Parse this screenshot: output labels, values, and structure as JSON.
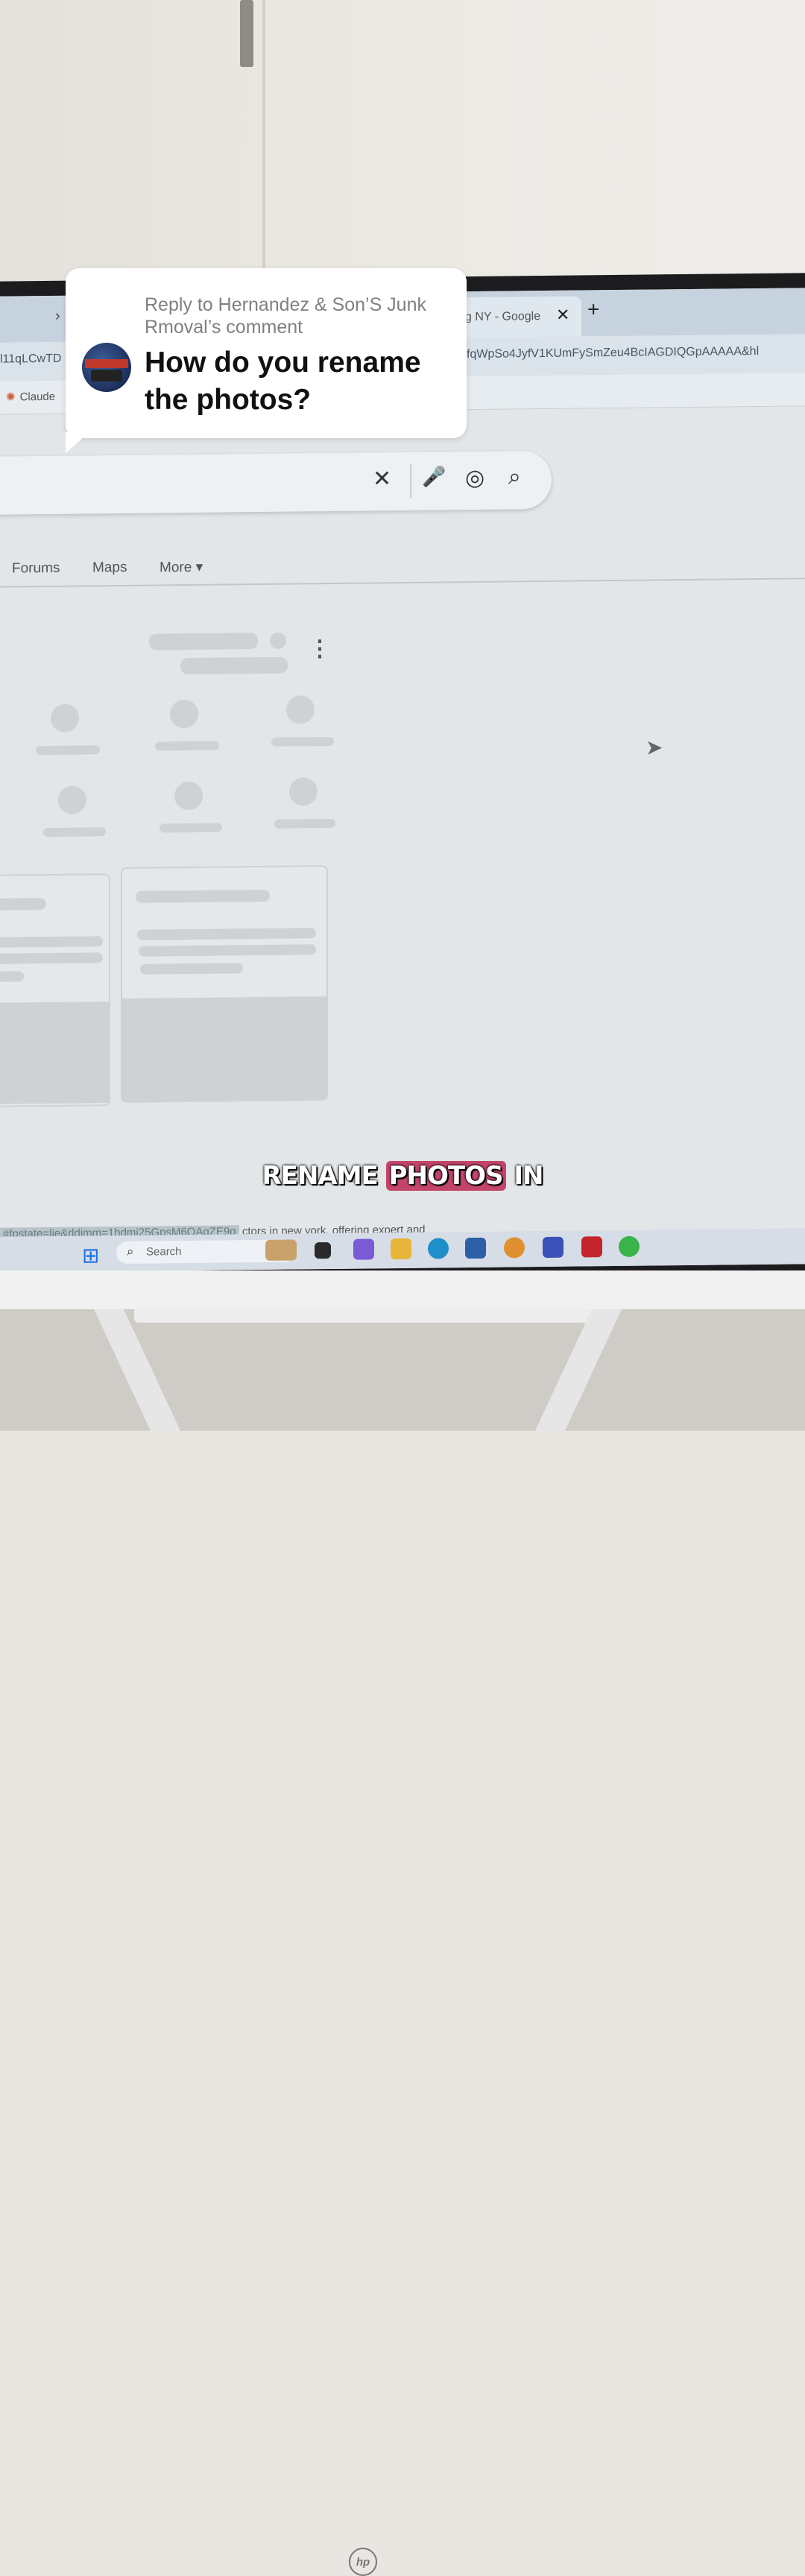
{
  "browser": {
    "active_tab_title": "g NY - Google",
    "close_tab_glyph": "✕",
    "new_tab_glyph": "+",
    "left_tab_glyph": "›",
    "url_left": "l11qLCwTD",
    "url_right": "fqWpSo4JyfV1KUmFySmZeu4BcIAGDIQGpAAAAA&hl",
    "bookmark": "Claude"
  },
  "search": {
    "clear_glyph": "✕",
    "mic_glyph": "🎤",
    "lens_glyph": "◎",
    "search_glyph": "⌕"
  },
  "nav_tabs": [
    "Forums",
    "Maps",
    "More ▾"
  ],
  "results": {
    "kebab_glyph": "⋮",
    "status_text": "ctors in new york, offering expert and",
    "status_link": "#fpstate=lie&rldimm=1hdmi25GpsM6OAgZE9g"
  },
  "taskbar": {
    "search_placeholder": "Search",
    "search_glyph": "⌕",
    "start_glyph": "⊞"
  },
  "monitor": {
    "brand": "hp"
  },
  "caption": {
    "word1": "RENAME",
    "word2": "PHOTOS",
    "word3": "IN"
  },
  "comment": {
    "reply_to": "Reply to Hernandez & Son’S Junk Rmoval’s comment",
    "question": "How do you rename the photos?"
  }
}
